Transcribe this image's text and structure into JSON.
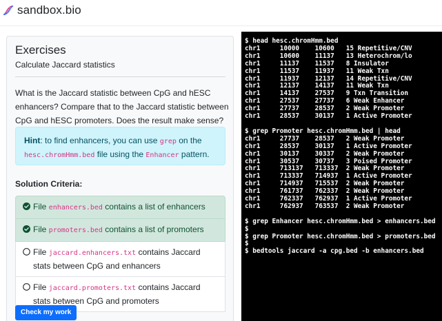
{
  "brand": {
    "name": "sandbox.bio",
    "icon": "dna-icon"
  },
  "exercise": {
    "title": "Exercises",
    "subtitle": "Calculate Jaccard statistics",
    "question": "What is the Jaccard statistic between CpG and hESC enhancers? Compare that to the Jaccard statistic between CpG and hESC promoters. Does the result make sense?",
    "hint": {
      "label": "Hint",
      "text_1": ": to find enhancers, you can use ",
      "code_1": "grep",
      "text_2": " on the ",
      "code_2": "hesc.chromHmm.bed",
      "text_3": " file using the ",
      "code_3": "Enhancer",
      "text_4": " pattern."
    },
    "criteria_title": "Solution Criteria:",
    "criteria": [
      {
        "pre": "File ",
        "code": "enhancers.bed",
        "post": " contains a list of enhancers",
        "done": true
      },
      {
        "pre": "File ",
        "code": "promoters.bed",
        "post": " contains a list of promoters",
        "done": true
      },
      {
        "pre": "File ",
        "code": "jaccard.enhancers.txt",
        "post": " contains Jaccard stats between CpG and enhancers",
        "done": false
      },
      {
        "pre": "File ",
        "code": "jaccard.promoters.txt",
        "post": " contains Jaccard stats between CpG and promoters",
        "done": false
      }
    ],
    "check_button": "Check my work"
  },
  "colors": {
    "done_bg": "#d1e7dd",
    "hint_bg": "#cff4fc",
    "button_bg": "#0d6efd",
    "code": "#d63384",
    "terminal_bg": "#000000"
  },
  "terminal": {
    "lines": [
      "$ head hesc.chromHmm.bed",
      "chr1     10000    10600   15 Repetitive/CNV",
      "chr1     10600    11137   13 Heterochrom/lo",
      "chr1     11137    11537   8 Insulator",
      "chr1     11537    11937   11 Weak Txn",
      "chr1     11937    12137   14 Repetitive/CNV",
      "chr1     12137    14137   11 Weak Txn",
      "chr1     14137    27537   9 Txn Transition",
      "chr1     27537    27737   6 Weak Enhancer",
      "chr1     27737    28537   2 Weak Promoter",
      "chr1     28537    30137   1 Active Promoter",
      "",
      "$ grep Promoter hesc.chromHmm.bed | head",
      "chr1     27737    28537   2 Weak Promoter",
      "chr1     28537    30137   1 Active Promoter",
      "chr1     30137    30337   2 Weak Promoter",
      "chr1     30537    30737   3 Poised Promoter",
      "chr1     713137   713337  2 Weak Promoter",
      "chr1     713337   714937  1 Active Promoter",
      "chr1     714937   715537  2 Weak Promoter",
      "chr1     761737   762337  2 Weak Promoter",
      "chr1     762337   762937  1 Active Promoter",
      "chr1     762937   763537  2 Weak Promoter",
      "",
      "$ grep Enhancer hesc.chromHmm.bed > enhancers.bed",
      "$",
      "$ grep Promoter hesc.chromHmm.bed > promoters.bed",
      "$",
      "$ bedtools jaccard -a cpg.bed -b enhancers.bed"
    ]
  }
}
